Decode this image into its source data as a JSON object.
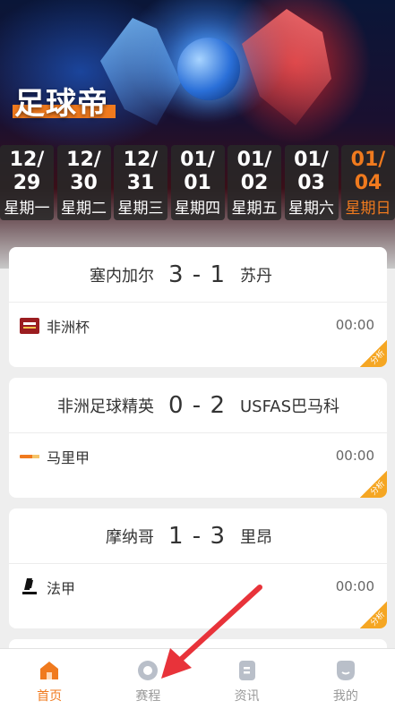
{
  "header": {
    "brand": "足球帝"
  },
  "colors": {
    "accent": "#f07a1e",
    "analysis": "#f5a623"
  },
  "dates": [
    {
      "date": "12/29",
      "weekday": "星期一",
      "active": false
    },
    {
      "date": "12/30",
      "weekday": "星期二",
      "active": false
    },
    {
      "date": "12/31",
      "weekday": "星期三",
      "active": false
    },
    {
      "date": "01/01",
      "weekday": "星期四",
      "active": false
    },
    {
      "date": "01/02",
      "weekday": "星期五",
      "active": false
    },
    {
      "date": "01/03",
      "weekday": "星期六",
      "active": false
    },
    {
      "date": "01/04",
      "weekday": "星期日",
      "active": true
    }
  ],
  "matches": [
    {
      "home": "塞内加尔",
      "score": "3 - 1",
      "away": "苏丹",
      "league": "非洲杯",
      "league_icon": "africa-cup-logo-icon",
      "time": "00:00",
      "analysis": "分析"
    },
    {
      "home": "非洲足球精英",
      "score": "0 - 2",
      "away": "USFAS巴马科",
      "league": "马里甲",
      "league_icon": "mali-league-logo-icon",
      "time": "00:00",
      "analysis": "分析"
    },
    {
      "home": "摩纳哥",
      "score": "1 - 3",
      "away": "里昂",
      "league": "法甲",
      "league_icon": "ligue1-logo-icon",
      "time": "00:00",
      "analysis": "分析"
    }
  ],
  "tabs": [
    {
      "label": "首页",
      "icon": "home-icon",
      "active": true
    },
    {
      "label": "赛程",
      "icon": "schedule-icon",
      "active": false
    },
    {
      "label": "资讯",
      "icon": "news-icon",
      "active": false
    },
    {
      "label": "我的",
      "icon": "profile-icon",
      "active": false
    }
  ]
}
